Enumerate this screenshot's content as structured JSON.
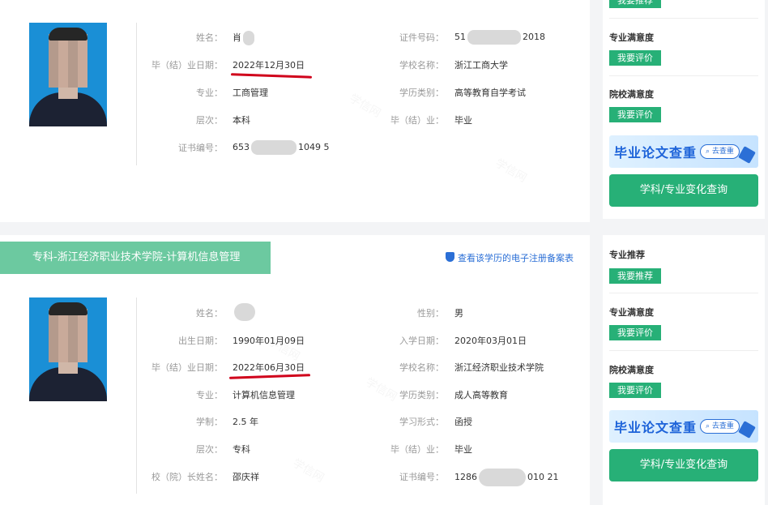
{
  "records": [
    {
      "fields_left": [
        {
          "label": "姓名：",
          "value": "肖"
        },
        {
          "label": "毕（结）业日期：",
          "value": "2022年12月30日"
        },
        {
          "label": "专业：",
          "value": "工商管理"
        },
        {
          "label": "层次：",
          "value": "本科"
        },
        {
          "label": "证书编号：",
          "value_a": "653",
          "value_b": "1049 5"
        }
      ],
      "fields_right": [
        {
          "label": "证件号码：",
          "value_a": "51",
          "value_b": "2018"
        },
        {
          "label": "学校名称：",
          "value": "浙江工商大学"
        },
        {
          "label": "学历类别：",
          "value": "高等教育自学考试"
        },
        {
          "label": "毕（结）业：",
          "value": "毕业"
        }
      ]
    },
    {
      "banner": "专科-浙江经济职业技术学院-计算机信息管理",
      "ereg_link": "查看该学历的电子注册备案表",
      "fields_left": [
        {
          "label": "姓名：",
          "value": ""
        },
        {
          "label": "出生日期：",
          "value": "1990年01月09日"
        },
        {
          "label": "毕（结）业日期：",
          "value": "2022年06月30日"
        },
        {
          "label": "专业：",
          "value": "计算机信息管理"
        },
        {
          "label": "学制：",
          "value": "2.5 年"
        },
        {
          "label": "层次：",
          "value": "专科"
        },
        {
          "label": "校（院）长姓名：",
          "value": "邵庆祥"
        }
      ],
      "fields_right": [
        {
          "label": "性别：",
          "value": "男"
        },
        {
          "label": "入学日期：",
          "value": "2020年03月01日"
        },
        {
          "label": "学校名称：",
          "value": "浙江经济职业技术学院"
        },
        {
          "label": "学历类别：",
          "value": "成人高等教育"
        },
        {
          "label": "学习形式：",
          "value": "函授"
        },
        {
          "label": "毕（结）业：",
          "value": "毕业"
        },
        {
          "label": "证书编号：",
          "value_a": "1286",
          "value_b": "010 21"
        }
      ]
    }
  ],
  "sidebar": {
    "major_recommend": "专业推荐",
    "recommend_btn": "我要推荐",
    "major_satisfaction": "专业满意度",
    "school_satisfaction": "院校满意度",
    "rate_btn": "我要评价",
    "promo_text": "毕业论文查重",
    "promo_btn": "去查重",
    "query_btn": "学科/专业变化查询"
  },
  "watermark": "学信网",
  "colors": {
    "accent_green": "#27b077",
    "banner_green": "#6cc9a0",
    "link_blue": "#2b6fd6",
    "underline_red": "#d0021b"
  }
}
